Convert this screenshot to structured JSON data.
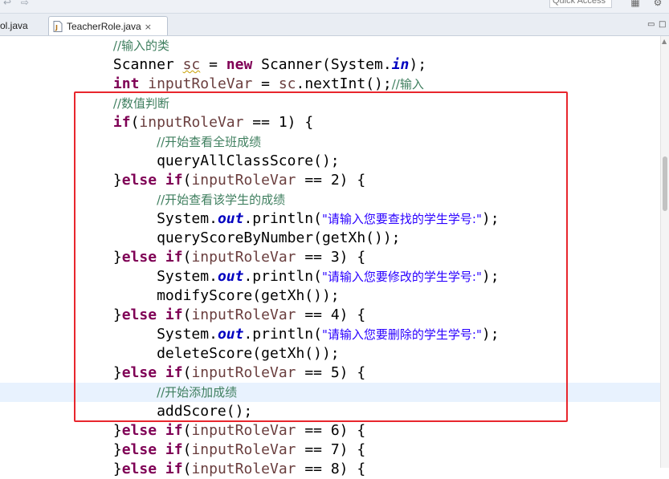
{
  "toolbar": {
    "quick_access": "Quick Access"
  },
  "tabs": [
    {
      "label": "ol.java",
      "active": false
    },
    {
      "label": "TeacherRole.java",
      "active": true,
      "close": "×"
    }
  ],
  "editor": {
    "lines": [
      "//输入的类",
      "Scanner sc = new Scanner(System.in);",
      "int inputRoleVar = sc.nextInt();//输入",
      "//数值判断",
      "if(inputRoleVar == 1) {",
      "//开始查看全班成绩",
      "queryAllClassScore();",
      "}else if(inputRoleVar == 2) {",
      "//开始查看该学生的成绩",
      "System.out.println(\"请输入您要查找的学生学号:\");",
      "queryScoreByNumber(getXh());",
      "}else if(inputRoleVar == 3) {",
      "System.out.println(\"请输入您要修改的学生学号:\");",
      "modifyScore(getXh());",
      "}else if(inputRoleVar == 4) {",
      "System.out.println(\"请输入您要删除的学生学号:\");",
      "deleteScore(getXh());",
      "}else if(inputRoleVar == 5) {",
      "//开始添加成绩",
      "addScore();",
      "}else if(inputRoleVar == 6) {",
      "}else if(inputRoleVar == 7) {",
      "}else if(inputRoleVar == 8) {"
    ],
    "highlighted_line": 18,
    "annotation_box": "red"
  },
  "colors": {
    "keyword": "#7f0055",
    "comment": "#3f7f5f",
    "string": "#2a00ff",
    "field": "#0000c0",
    "local_variable": "#6a3e3e",
    "annotation": "#e8262d",
    "current_line": "#e8f2fe"
  },
  "icons": [
    "back-icon",
    "forward-icon",
    "java-file-icon",
    "close-icon",
    "perspective-icon",
    "java-perspective-icon",
    "minimize-icon",
    "maximize-icon"
  ]
}
